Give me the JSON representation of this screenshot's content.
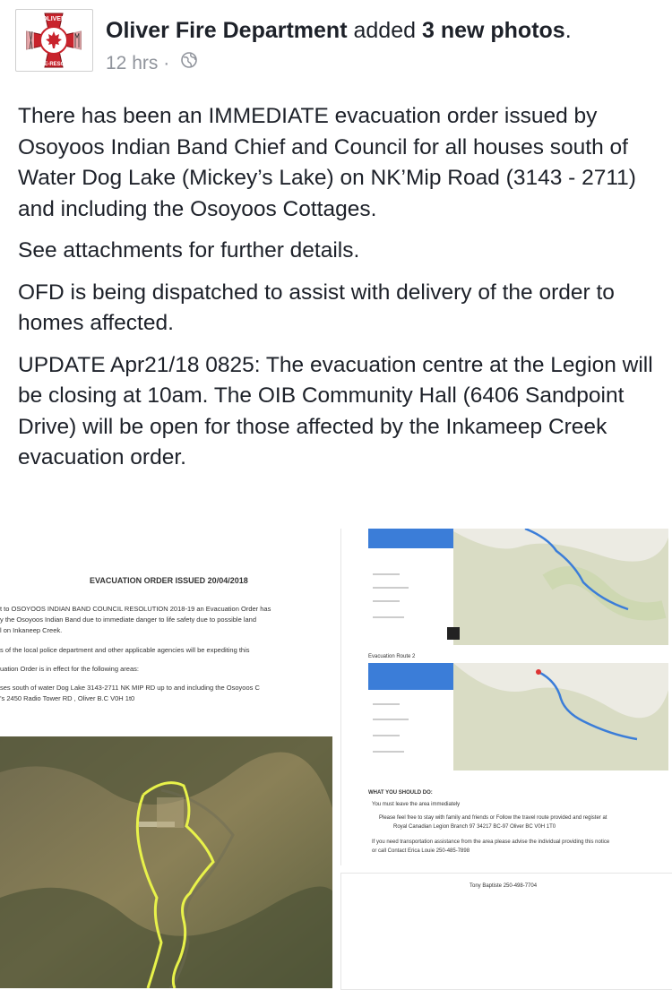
{
  "post": {
    "author": "Oliver Fire Department",
    "action": "added",
    "count_text": "3 new photos",
    "time": "12 hrs",
    "paragraphs": [
      "There has been an IMMEDIATE evacuation order issued by Osoyoos Indian Band Chief and Council for all houses south of Water Dog Lake (Mickey’s Lake) on NK’Mip Road (3143 - 2711) and including the Osoyoos Cottages.",
      "See attachments for further details.",
      "OFD is being dispatched to assist with delivery of the order to homes affected.",
      "UPDATE Apr21/18 0825: The evacuation centre at the Legion will be closing at 10am. The OIB Community Hall (6406 Sandpoint Drive) will be open for those affected by the Inkameep Creek evacuation order."
    ]
  },
  "logo": {
    "top_text": "OLIVER",
    "bottom_text": "FIRE-RESCUE",
    "colors": {
      "red": "#c8232c",
      "white": "#ffffff"
    }
  },
  "photo1": {
    "title": "EVACUATION ORDER ISSUED 20/04/2018",
    "lines": [
      "t to OSOYOOS INDIAN BAND COUNCIL RESOLUTION 2018-19 an Evacuation Order has",
      "y the Osoyoos Indian Band due to immediate danger to life safety due to possible land",
      "l on Inkaneep Creek.",
      "s of the local police department and other applicable agencies will be expediting this",
      "uation Order is in effect for the following areas:",
      "ses south of water Dog Lake 3143-2711 NK MIP RD up to and including the Osoyoos C",
      "’s  2450 Radio Tower RD , Oliver B.C V0H 1t0"
    ]
  },
  "photo2": {
    "route_label": "Evacuation Route 2",
    "what_title": "WHAT YOU SHOULD DO:",
    "bullets": [
      "You must leave the area immediately",
      "Please feel free to stay with family and friends or  Follow the travel route provided and register at",
      "Royal Canadian Legion Branch 97 34217 BC-97 Oliver BC V0H 1T0",
      "If you need transportation assistance from the area please advise the individual providing this notice",
      "or call Contact Erica Louie 250-485-7898"
    ]
  },
  "photo3": {
    "contact": "Tony Baptiste 250-498-7704"
  },
  "colors": {
    "text": "#1d2129",
    "meta": "#90949c",
    "map_route": "#3b7dd8",
    "boundary": "#e8f24a"
  }
}
